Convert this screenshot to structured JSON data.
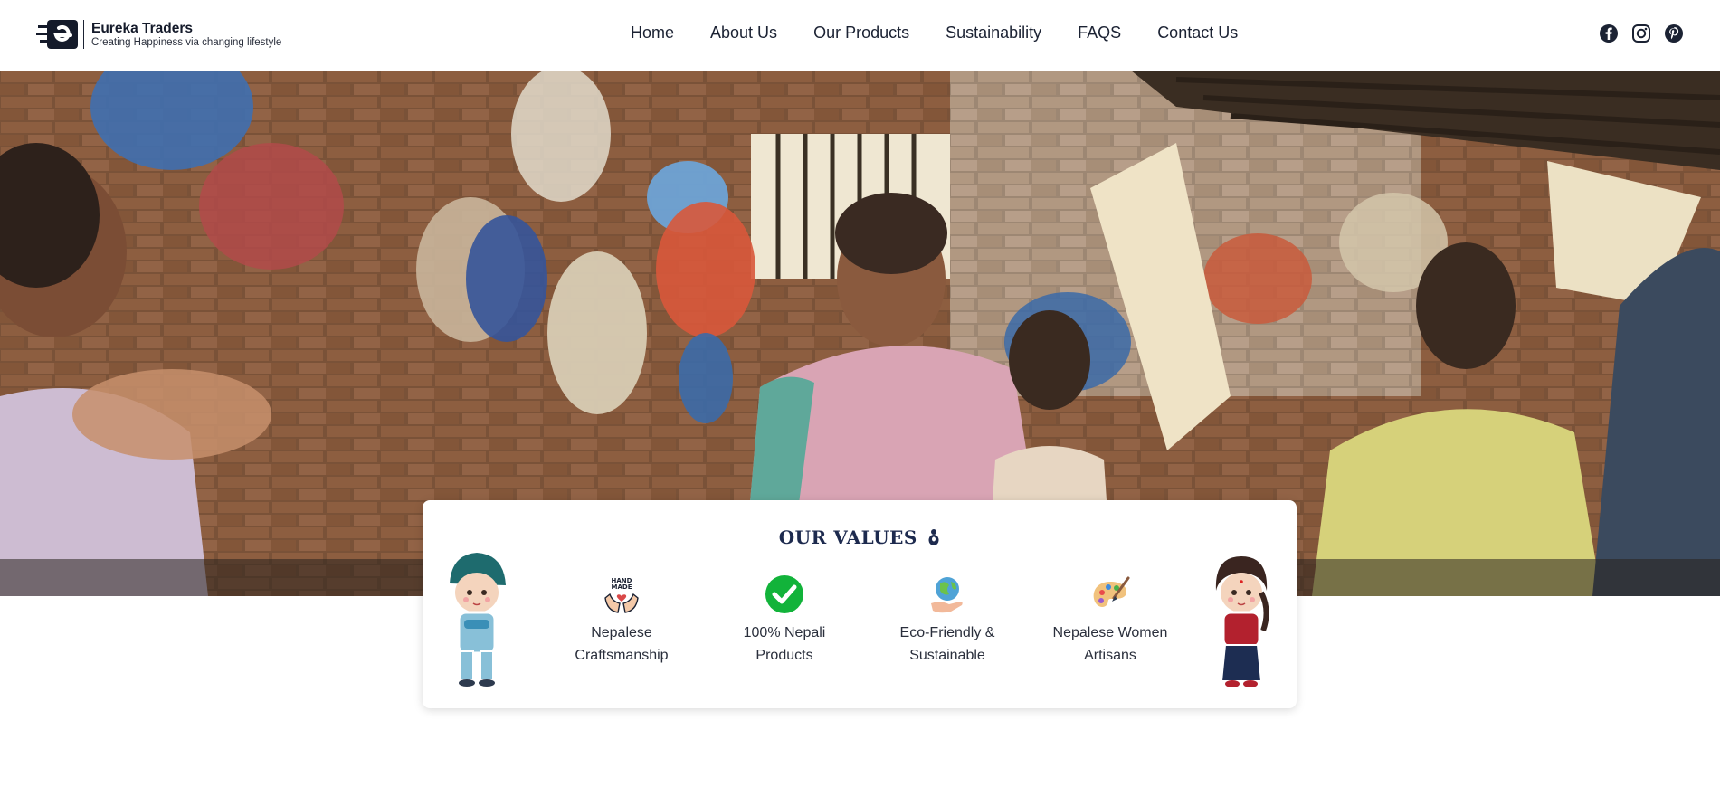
{
  "brand": {
    "name": "Eureka Traders",
    "tagline": "Creating Happiness via changing lifestyle",
    "logo_icon": "eureka-e-logo"
  },
  "nav": {
    "items": [
      {
        "label": "Home"
      },
      {
        "label": "About Us"
      },
      {
        "label": "Our Products"
      },
      {
        "label": "Sustainability"
      },
      {
        "label": "FAQS"
      },
      {
        "label": "Contact Us"
      }
    ]
  },
  "socials": [
    {
      "icon": "facebook-icon"
    },
    {
      "icon": "instagram-icon"
    },
    {
      "icon": "pinterest-icon"
    }
  ],
  "hero": {
    "image": "Nepali women artisans working in a workshop with bags hanging on brick wall"
  },
  "values": {
    "title": "OUR VALUES",
    "items": [
      {
        "line1": "Nepalese",
        "line2": "Craftsmanship",
        "icon": "handmade-hands-icon"
      },
      {
        "line1": "100% Nepali",
        "line2": "Products",
        "icon": "green-check-icon"
      },
      {
        "line1": "Eco-Friendly &",
        "line2": "Sustainable",
        "icon": "globe-in-hand-icon"
      },
      {
        "line1": "Nepalese Women",
        "line2": "Artisans",
        "icon": "paint-palette-icon"
      }
    ]
  },
  "colors": {
    "brand_dark": "#1d2a4e",
    "check_green": "#12b33a"
  }
}
